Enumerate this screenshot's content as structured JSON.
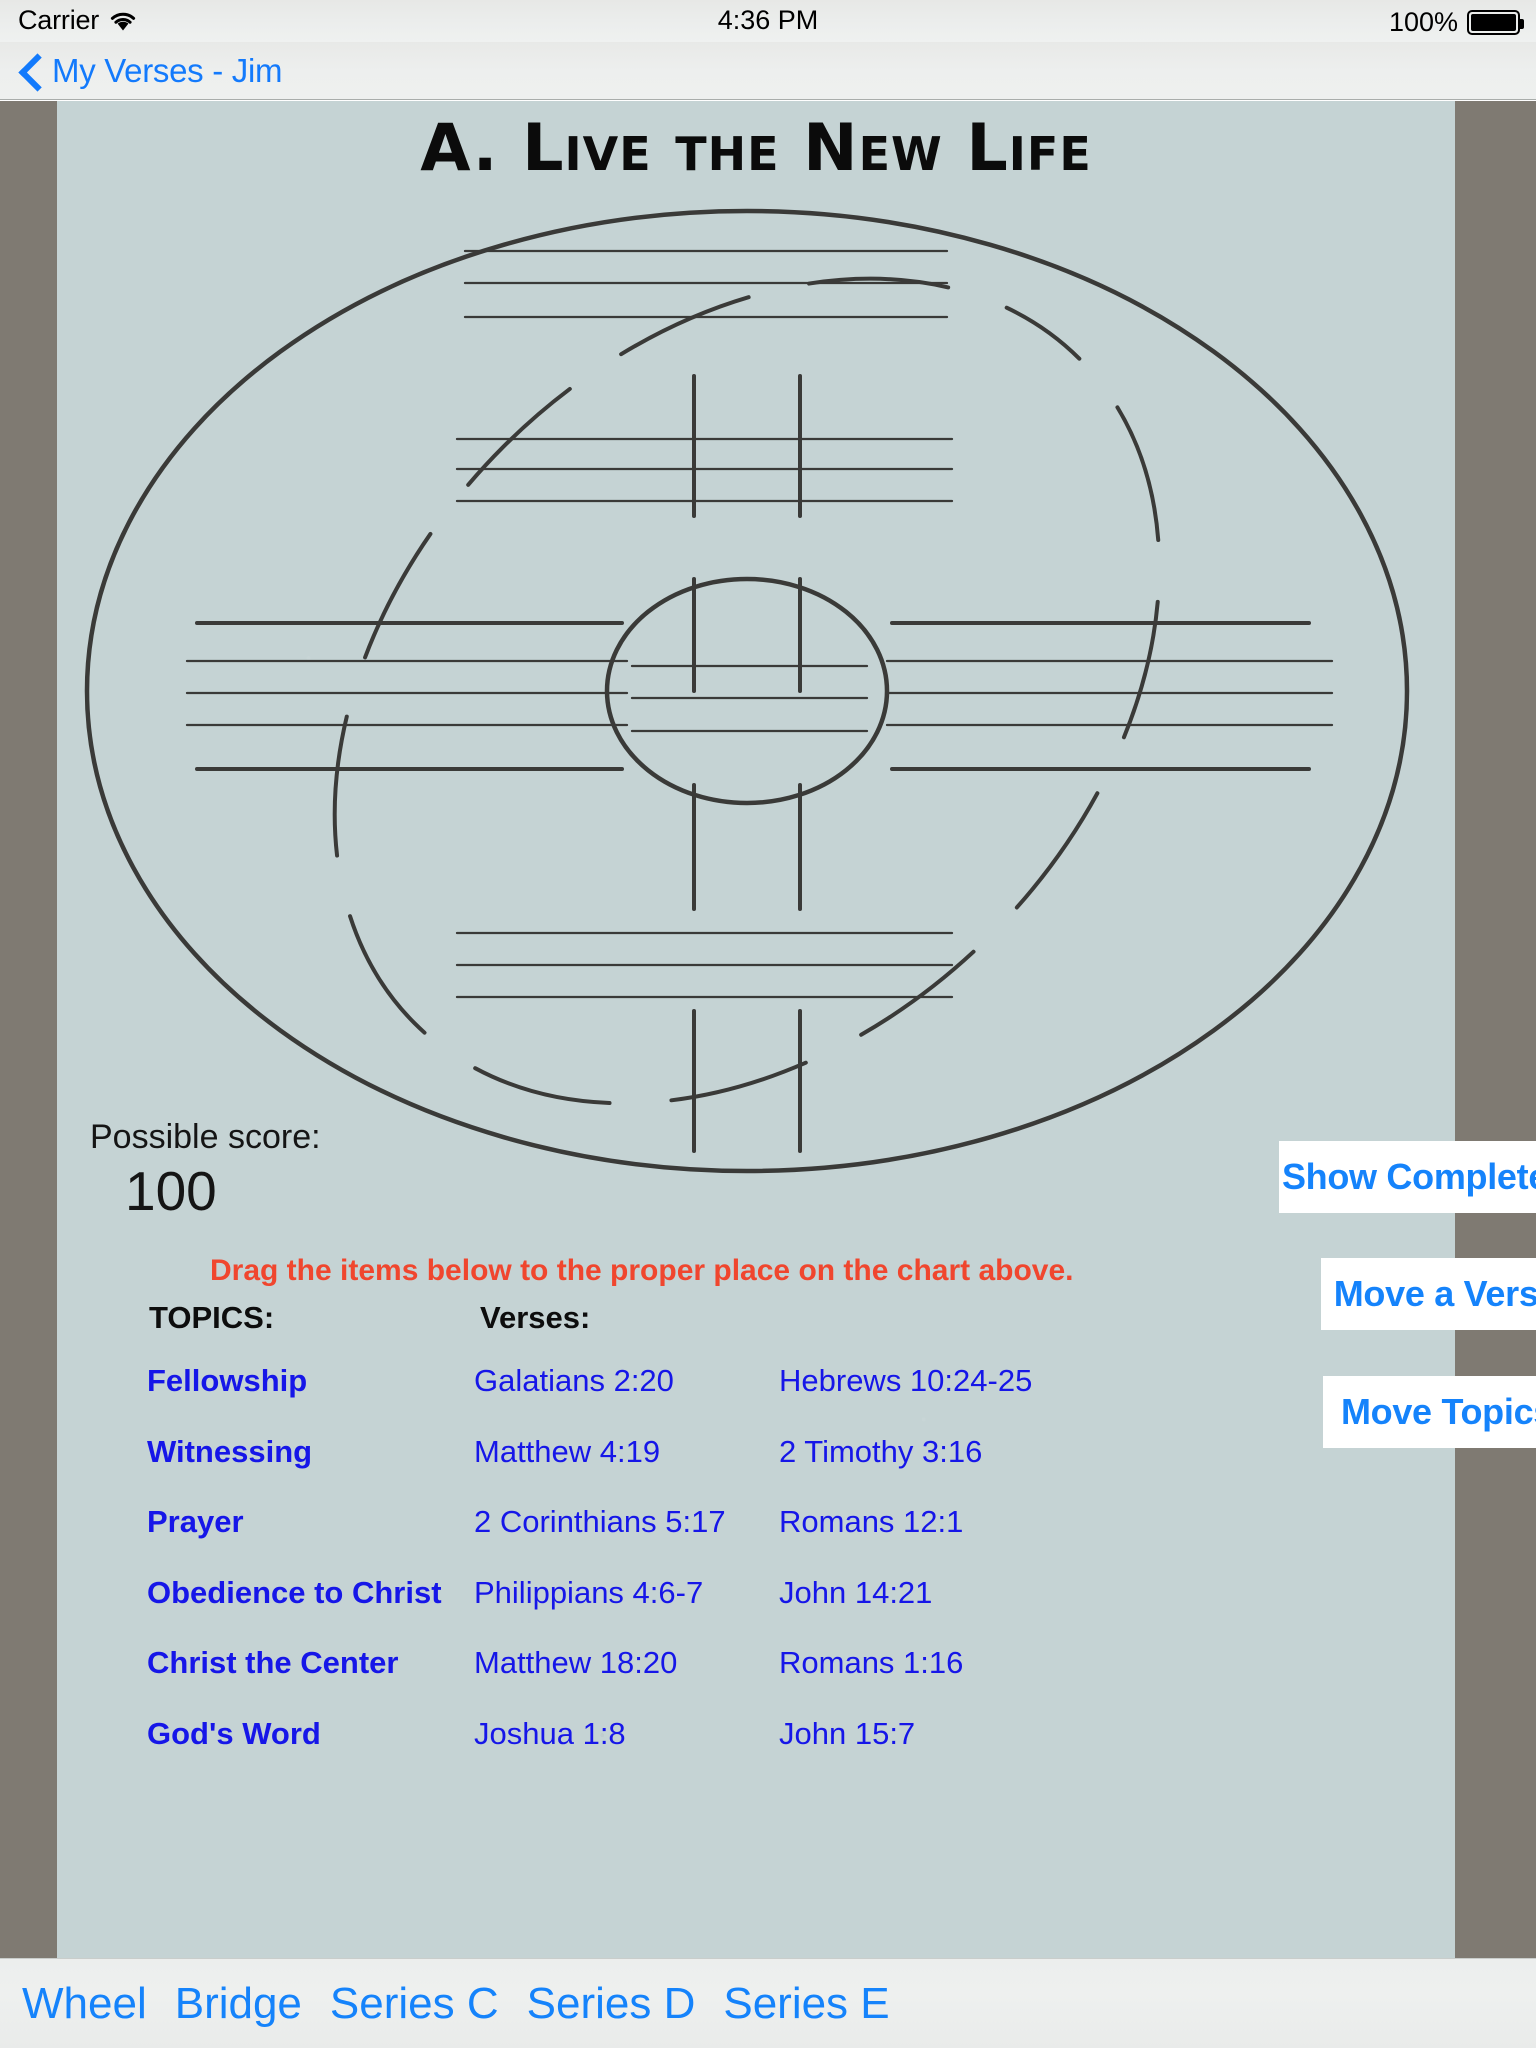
{
  "status_bar": {
    "carrier": "Carrier",
    "wifi_icon": "wifi-icon",
    "time": "4:36 PM",
    "battery_percent": "100%",
    "battery_icon": "battery-full-icon"
  },
  "nav_bar": {
    "back_icon": "chevron-left-icon",
    "back_label": "My Verses - Jim"
  },
  "worksheet": {
    "title": "A. Live the New Life",
    "diagram_name": "navigators-wheel-diagram",
    "score_label": "Possible score:",
    "score_value": "100",
    "instruction": "Drag the items below to the proper place on the chart above."
  },
  "actions": [
    {
      "id": "show-complete",
      "label": "Show Complete"
    },
    {
      "id": "move-verse",
      "label": "Move a Verse"
    },
    {
      "id": "move-topics",
      "label": "Move Topics"
    }
  ],
  "lists": {
    "topics_header": "TOPICS:",
    "verses_header": "Verses:",
    "topics": [
      "Fellowship",
      "Witnessing",
      "Prayer",
      "Obedience to Christ",
      "Christ the Center",
      "God's Word"
    ],
    "verses_column_1": [
      "Galatians 2:20",
      "Matthew 4:19",
      "2 Corinthians 5:17",
      "Philippians 4:6-7",
      "Matthew 18:20",
      "Joshua 1:8"
    ],
    "verses_column_2": [
      "Hebrews 10:24-25",
      "2 Timothy 3:16",
      "Romans 12:1",
      "John 14:21",
      "Romans 1:16",
      "John 15:7"
    ]
  },
  "tab_bar": {
    "tabs": [
      "Wheel",
      "Bridge",
      "Series C",
      "Series D",
      "Series E"
    ]
  },
  "colors": {
    "accent_blue": "#1583fb",
    "list_blue": "#1616e8",
    "instruction_red": "#f0462e",
    "paper": "#c5d3d4",
    "photo_border": "#7f7a72"
  }
}
